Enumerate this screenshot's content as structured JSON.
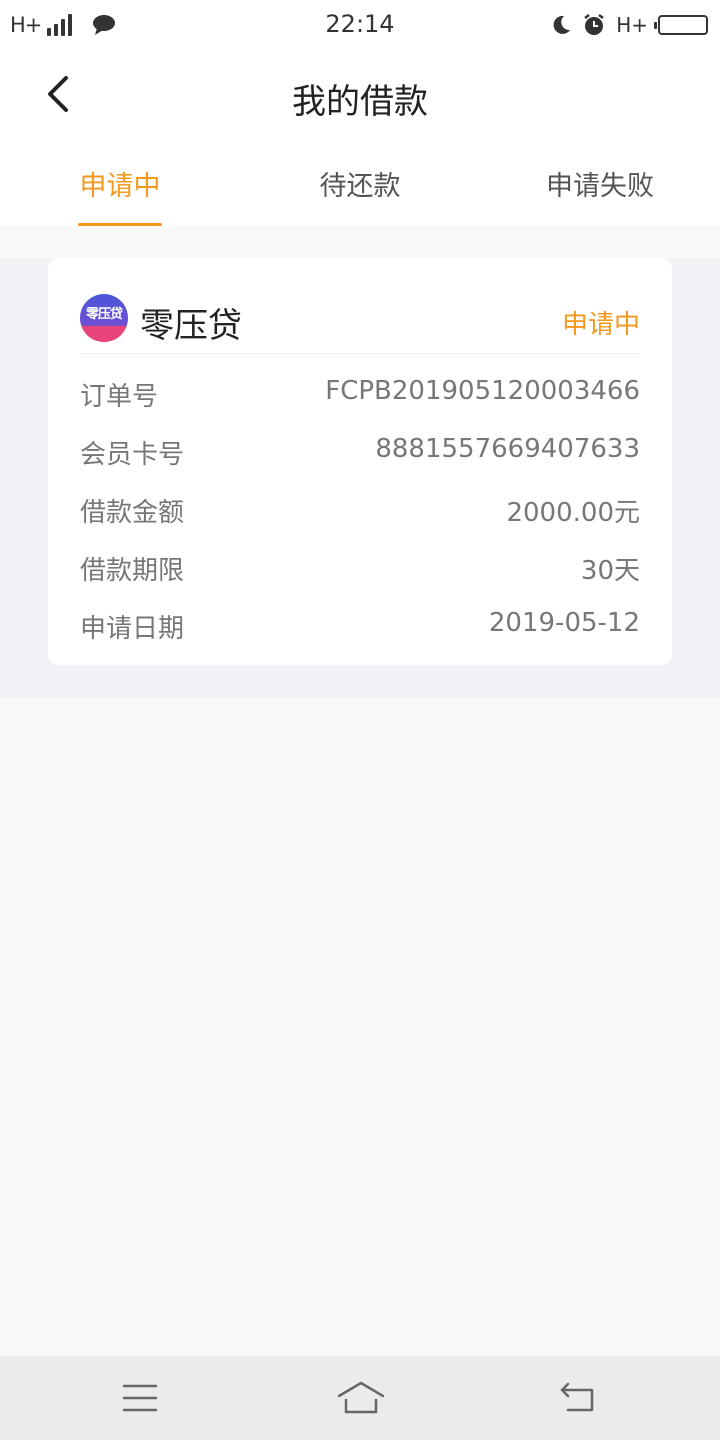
{
  "status_bar": {
    "network_left": "H+",
    "time": "22:14",
    "network_right": "H+"
  },
  "header": {
    "title": "我的借款",
    "back_icon": "chevron-left-icon"
  },
  "tabs": [
    {
      "label": "申请中",
      "active": true
    },
    {
      "label": "待还款",
      "active": false
    },
    {
      "label": "申请失败",
      "active": false
    }
  ],
  "colors": {
    "accent": "#f39a1e",
    "page_bg": "#f1f2f6",
    "card_bg": "#ffffff"
  },
  "loan_card": {
    "logo_text": "零压贷",
    "brand_name": "零压贷",
    "status": "申请中",
    "rows": [
      {
        "label": "订单号",
        "value": "FCPB201905120003466"
      },
      {
        "label": "会员卡号",
        "value": "8881557669407633"
      },
      {
        "label": "借款金额",
        "value": "2000.00元"
      },
      {
        "label": "借款期限",
        "value": "30天"
      },
      {
        "label": "申请日期",
        "value": "2019-05-12"
      }
    ]
  },
  "nav_bar": {
    "menu_icon": "menu-icon",
    "home_icon": "home-icon",
    "back_icon": "back-arrow-icon"
  }
}
